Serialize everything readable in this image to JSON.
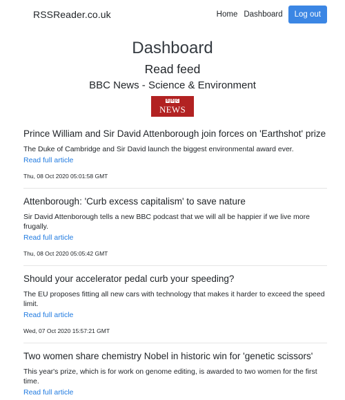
{
  "navbar": {
    "brand": "RSSReader.co.uk",
    "links": [
      "Home",
      "Dashboard"
    ],
    "logout_label": "Log out",
    "accent_color": "#3b86e4"
  },
  "header": {
    "title": "Dashboard",
    "subtitle": "Read feed",
    "feed_name": "BBC News - Science & Environment",
    "logo": {
      "blocks": [
        "B",
        "B",
        "C"
      ],
      "text": "NEWS",
      "color": "#b22222"
    }
  },
  "articles": [
    {
      "title": "Prince William and Sir David Attenborough join forces on 'Earthshot' prize",
      "description": "The Duke of Cambridge and Sir David launch the biggest environmental award ever.",
      "link_label": "Read full article",
      "date": "Thu, 08 Oct 2020 05:01:58 GMT"
    },
    {
      "title": "Attenborough: 'Curb excess capitalism' to save nature",
      "description": "Sir David Attenborough tells a new BBC podcast that we will all be happier if we live more frugally.",
      "link_label": "Read full article",
      "date": "Thu, 08 Oct 2020 05:05:42 GMT"
    },
    {
      "title": "Should your accelerator pedal curb your speeding?",
      "description": "The EU proposes fitting all new cars with technology that makes it harder to exceed the speed limit.",
      "link_label": "Read full article",
      "date": "Wed, 07 Oct 2020 15:57:21 GMT"
    },
    {
      "title": "Two women share chemistry Nobel in historic win for 'genetic scissors'",
      "description": "This year's prize, which is for work on genome editing, is awarded to two women for the first time.",
      "link_label": "Read full article",
      "date": ""
    }
  ]
}
